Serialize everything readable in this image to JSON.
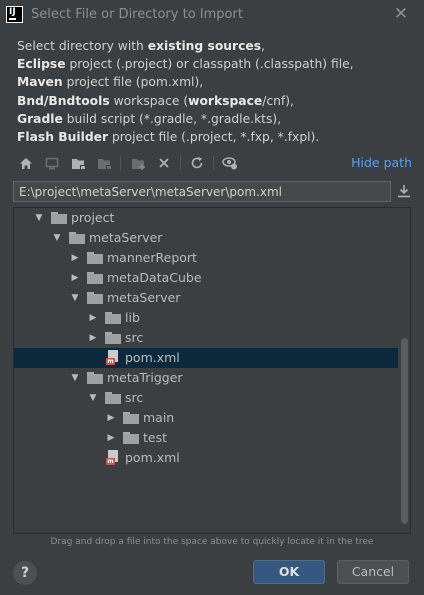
{
  "window": {
    "title": "Select File or Directory to Import"
  },
  "description": {
    "intro": "Select directory with ",
    "intro_bold": "existing sources",
    "intro_end": ",",
    "line2_bold": "Eclipse",
    "line2": " project (.project) or classpath (.classpath) file,",
    "line3_bold": "Maven",
    "line3": " project file (pom.xml),",
    "line4_bold": "Bnd/Bndtools",
    "line4_mid": " workspace (",
    "line4_bold2": "workspace",
    "line4_end": "/cnf),",
    "line5_bold": "Gradle",
    "line5": " build script (*.gradle, *.gradle.kts),",
    "line6_bold": "Flash Builder",
    "line6": " project file (.project, *.fxp, *.fxpl)."
  },
  "toolbar": {
    "icons": [
      "home-icon",
      "desktop-icon",
      "project-folder-icon",
      "module-folder-icon",
      "new-folder-icon",
      "delete-icon",
      "refresh-icon",
      "show-hidden-icon"
    ],
    "hide_path_label": "Hide path"
  },
  "path": {
    "value": "E:\\project\\metaServer\\metaServer\\pom.xml"
  },
  "tree": {
    "items": [
      {
        "label": "project",
        "type": "folder",
        "expanded": true,
        "depth": 0
      },
      {
        "label": "metaServer",
        "type": "folder",
        "expanded": true,
        "depth": 1
      },
      {
        "label": "mannerReport",
        "type": "folder",
        "expanded": false,
        "depth": 2
      },
      {
        "label": "metaDataCube",
        "type": "folder",
        "expanded": false,
        "depth": 2
      },
      {
        "label": "metaServer",
        "type": "folder",
        "expanded": true,
        "depth": 2
      },
      {
        "label": "lib",
        "type": "folder",
        "expanded": false,
        "depth": 3
      },
      {
        "label": "src",
        "type": "folder",
        "expanded": false,
        "depth": 3
      },
      {
        "label": "pom.xml",
        "type": "maven-file",
        "selected": true,
        "depth": 3
      },
      {
        "label": "metaTrigger",
        "type": "folder",
        "expanded": true,
        "depth": 2
      },
      {
        "label": "src",
        "type": "folder",
        "expanded": true,
        "depth": 3
      },
      {
        "label": "main",
        "type": "folder",
        "expanded": false,
        "depth": 4
      },
      {
        "label": "test",
        "type": "folder",
        "expanded": false,
        "depth": 4
      },
      {
        "label": "pom.xml",
        "type": "maven-file",
        "depth": 3
      }
    ]
  },
  "hint": "Drag and drop a file into the space above to quickly locate it in the tree",
  "buttons": {
    "help": "?",
    "ok": "OK",
    "cancel": "Cancel"
  },
  "colors": {
    "accent": "#589df6",
    "selection": "#0d293e",
    "ok": "#365880",
    "background": "#3c3f41"
  }
}
